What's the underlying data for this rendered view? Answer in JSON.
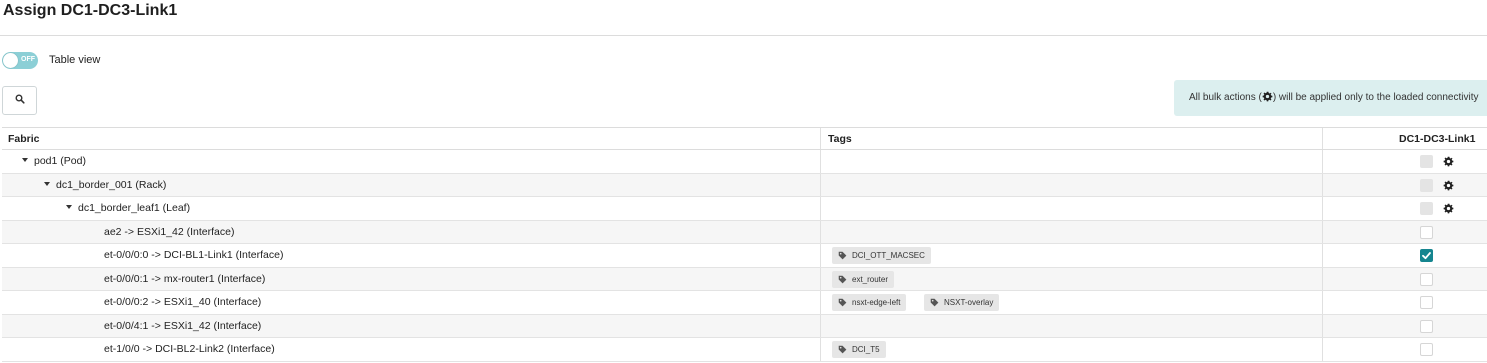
{
  "page": {
    "title": "Assign DC1-DC3-Link1"
  },
  "toolbar": {
    "toggle_state": "OFF",
    "toggle_label": "Table view",
    "search_icon": "search-icon"
  },
  "banner": {
    "text_before": "All bulk actions (",
    "text_after": ") will be applied only to the loaded connectivity"
  },
  "table": {
    "columns": {
      "fabric": "Fabric",
      "tags": "Tags",
      "assignment": "DC1-DC3-Link1"
    },
    "rows": [
      {
        "label": "pod1 (Pod)",
        "tags": [],
        "checked": false,
        "bulk": true
      },
      {
        "label": "dc1_border_001 (Rack)",
        "tags": [],
        "checked": false,
        "bulk": true
      },
      {
        "label": "dc1_border_leaf1 (Leaf)",
        "tags": [],
        "checked": false,
        "bulk": true
      },
      {
        "label": "ae2 -> ESXi1_42 (Interface)",
        "tags": [],
        "checked": false,
        "bulk": false
      },
      {
        "label": "et-0/0/0:0 -> DCI-BL1-Link1 (Interface)",
        "tags": [
          "DCI_OTT_MACSEC"
        ],
        "checked": true,
        "bulk": false
      },
      {
        "label": "et-0/0/0:1 -> mx-router1 (Interface)",
        "tags": [
          "ext_router"
        ],
        "checked": false,
        "bulk": false
      },
      {
        "label": "et-0/0/0:2 -> ESXi1_40 (Interface)",
        "tags": [
          "nsxt-edge-left",
          "NSXT-overlay"
        ],
        "checked": false,
        "bulk": false
      },
      {
        "label": "et-0/0/4:1 -> ESXi1_42 (Interface)",
        "tags": [],
        "checked": false,
        "bulk": false
      },
      {
        "label": "et-1/0/0 -> DCI-BL2-Link2 (Interface)",
        "tags": [
          "DCI_T5"
        ],
        "checked": false,
        "bulk": false
      }
    ]
  },
  "colors": {
    "accent": "#15858f",
    "toggle_off": "#8ccfd6",
    "banner_bg": "#dcefef",
    "tag_bg": "#e6e6e6"
  }
}
